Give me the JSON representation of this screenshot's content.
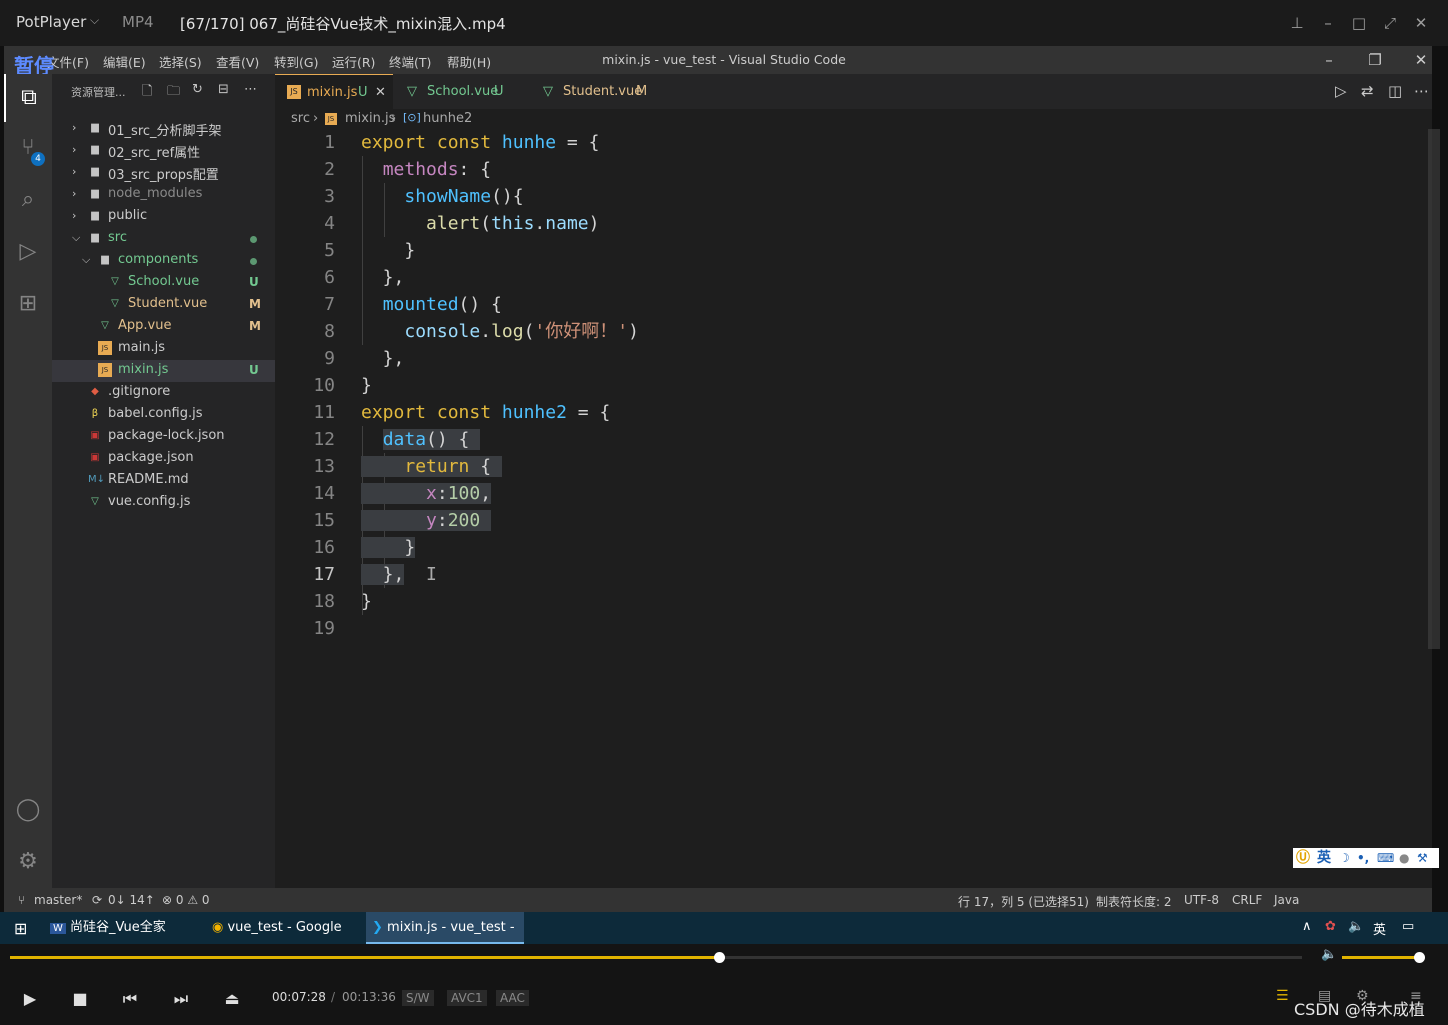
{
  "player": {
    "app_name": "PotPlayer",
    "format": "MP4",
    "title": "[67/170] 067_尚硅谷Vue技术_mixin混入.mp4",
    "pause_label": "暂停",
    "time_current": "00:07:28",
    "time_total": "00:13:36",
    "tags": [
      "S/W",
      "AVC1",
      "AAC"
    ],
    "progress_fraction": 0.549,
    "watermark": "CSDN @待木成植"
  },
  "vscode": {
    "window_title": "mixin.js - vue_test - Visual Studio Code",
    "menu": [
      "文件(F)",
      "编辑(E)",
      "选择(S)",
      "查看(V)",
      "转到(G)",
      "运行(R)",
      "终端(T)",
      "帮助(H)"
    ],
    "sidebar_title": "资源管理...",
    "scm_badge": "4",
    "explorer": [
      {
        "label": "01_src_分析脚手架",
        "kind": "folder",
        "depth": 0,
        "open": false
      },
      {
        "label": "02_src_ref属性",
        "kind": "folder",
        "depth": 0,
        "open": false
      },
      {
        "label": "03_src_props配置",
        "kind": "folder",
        "depth": 0,
        "open": false
      },
      {
        "label": "node_modules",
        "kind": "folder",
        "depth": 0,
        "open": false,
        "dim": true
      },
      {
        "label": "public",
        "kind": "folder",
        "depth": 0,
        "open": false
      },
      {
        "label": "src",
        "kind": "folder",
        "depth": 0,
        "open": true,
        "color": "#73c991"
      },
      {
        "label": "components",
        "kind": "folder",
        "depth": 1,
        "open": true,
        "color": "#73c991"
      },
      {
        "label": "School.vue",
        "kind": "vue",
        "depth": 2,
        "status": "U",
        "color": "#73c991"
      },
      {
        "label": "Student.vue",
        "kind": "vue",
        "depth": 2,
        "status": "M",
        "color": "#e2c08d"
      },
      {
        "label": "App.vue",
        "kind": "vue",
        "depth": 1,
        "status": "M",
        "color": "#e2c08d"
      },
      {
        "label": "main.js",
        "kind": "js",
        "depth": 1
      },
      {
        "label": "mixin.js",
        "kind": "js",
        "depth": 1,
        "status": "U",
        "color": "#73c991",
        "selected": true
      },
      {
        "label": ".gitignore",
        "kind": "git",
        "depth": 0
      },
      {
        "label": "babel.config.js",
        "kind": "babel",
        "depth": 0
      },
      {
        "label": "package-lock.json",
        "kind": "npm",
        "depth": 0
      },
      {
        "label": "package.json",
        "kind": "npm",
        "depth": 0
      },
      {
        "label": "README.md",
        "kind": "md",
        "depth": 0
      },
      {
        "label": "vue.config.js",
        "kind": "vue",
        "depth": 0
      }
    ],
    "tabs": [
      {
        "label": "mixin.js",
        "status": "U",
        "active": true
      },
      {
        "label": "School.vue",
        "status": "U"
      },
      {
        "label": "Student.vue",
        "status": "M"
      }
    ],
    "breadcrumb": [
      "src",
      "mixin.js",
      "hunhe2"
    ],
    "current_line": "17",
    "status": {
      "branch": "master*",
      "sync": "0↓ 14↑",
      "problems": "⊗ 0 ⚠ 0",
      "position": "行 17，列 5 (已选择51)",
      "tabsize": "制表符长度: 2",
      "encoding": "UTF-8",
      "eol": "CRLF",
      "lang": "Java"
    }
  },
  "ime": {
    "label": "英"
  },
  "taskbar": {
    "items": [
      "尚硅谷_Vue全家桶.d...",
      "vue_test - Google C...",
      "mixin.js - vue_test - ..."
    ],
    "tray_lang": "英"
  },
  "colors": {
    "accent": "#e2b400",
    "vscode_blue": "#0e70c0"
  }
}
